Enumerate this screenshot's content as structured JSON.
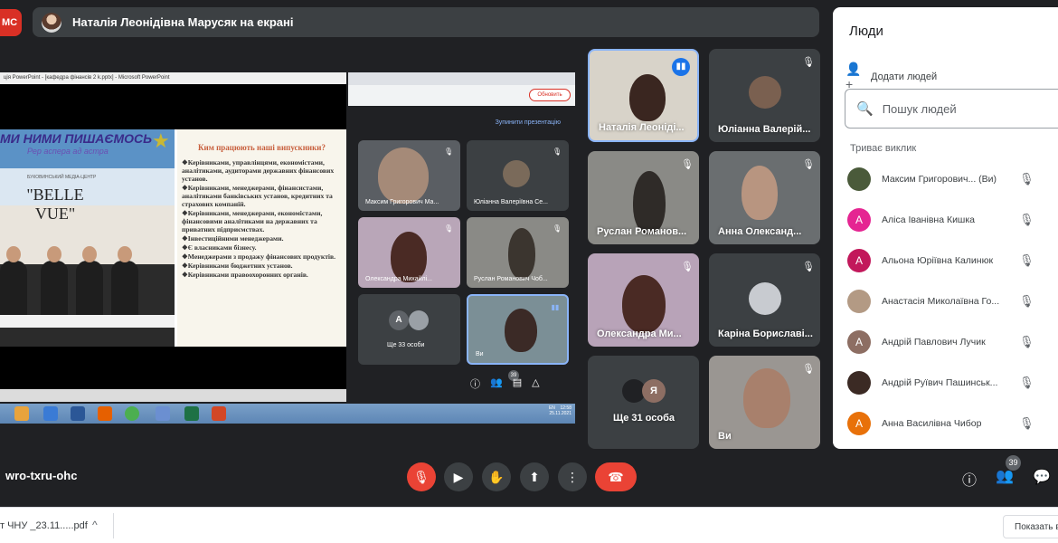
{
  "recording_badge": "МС",
  "presenting_chip": {
    "text": "Наталія Леонідівна Марусяк на екрані"
  },
  "shared_screen": {
    "ppt_title": "ція PowerPoint - [кафедра фінансів 2 k.pptx] - Microsoft PowerPoint",
    "slide": {
      "banner": "МИ НИМИ ПИШАЄМОСЬ",
      "banner_sub": "Рер аспера ад астра",
      "media_text": "БУКОВИНСЬКИЙ МЕДІА-ЦЕНТР",
      "belle_vue": "\"BELLE VUE\"",
      "heading": "Ким працюють наші випускники?",
      "bullets": [
        "❖Керівниками, управлінцями, економістами, аналітиками, аудиторами державних фінансових установ.",
        "❖Керівниками, менеджерами, фінансистами, аналітиками банківських установ, кредитних та страхових компаній.",
        "❖Керівниками, менеджерами, економістами, фінансовими аналітиками на державних та приватних підприємствах.",
        "❖Інвестиційними менеджерами.",
        "❖Є власниками бізнесу.",
        "❖Менеджерами з продажу фінансових продуктів.",
        "❖Керівниками бюджетних установ.",
        "❖Керівниками правоохоронних органів."
      ]
    },
    "taskbar_lang": "EN",
    "taskbar_time": "12:58",
    "taskbar_date": "25.11.2021",
    "browser_update": "Обновить",
    "stop_presentation": "Зупинити презентацію",
    "inner_tiles": [
      {
        "name": "Максим Григорович Ма..."
      },
      {
        "name": "Юліанна Валеріївна Се..."
      },
      {
        "name": "Олександра Михайлі..."
      },
      {
        "name": "Руслан Романович Чоб..."
      },
      {
        "name": "Ще 33 особи",
        "avatar": "A"
      },
      {
        "name": "Ви"
      }
    ],
    "inner_people_count": "39"
  },
  "tiles": [
    {
      "name": "Наталія Леоніді...",
      "speaking": true
    },
    {
      "name": "Юліанна Валерій..."
    },
    {
      "name": "Руслан Романов..."
    },
    {
      "name": "Анна Олександ..."
    },
    {
      "name": "Олександра Ми..."
    },
    {
      "name": "Каріна Бориславі..."
    },
    {
      "name": "Ще 31 особа",
      "avatar": "Я"
    },
    {
      "name": "Ви"
    }
  ],
  "people_panel": {
    "title": "Люди",
    "add_people": "Додати людей",
    "search_placeholder": "Пошук людей",
    "in_call_label": "Триває виклик",
    "participants": [
      {
        "name": "Максим Григорович... (Ви)",
        "avatar": "",
        "color": "#4a5a3a"
      },
      {
        "name": "Аліса Іванівна Кишка",
        "avatar": "A",
        "color": "#e52592"
      },
      {
        "name": "Альона Юріївна Калинюк",
        "avatar": "A",
        "color": "#c2185b"
      },
      {
        "name": "Анастасія Миколаївна Го...",
        "avatar": "",
        "color": "#b39a84"
      },
      {
        "name": "Андрій Павлович Лучик",
        "avatar": "A",
        "color": "#8d6e63"
      },
      {
        "name": "Андрій Руївич Пашинськ...",
        "avatar": "",
        "color": "#3b2a24"
      },
      {
        "name": "Анна Василівна Чибор",
        "avatar": "A",
        "color": "#e8710a"
      }
    ]
  },
  "bottom_bar": {
    "meeting_code": "wro-txru-ohc",
    "people_count": "39"
  },
  "download_bar": {
    "file": "т ЧНУ _23.11.....pdf",
    "show_all": "Показать в"
  }
}
